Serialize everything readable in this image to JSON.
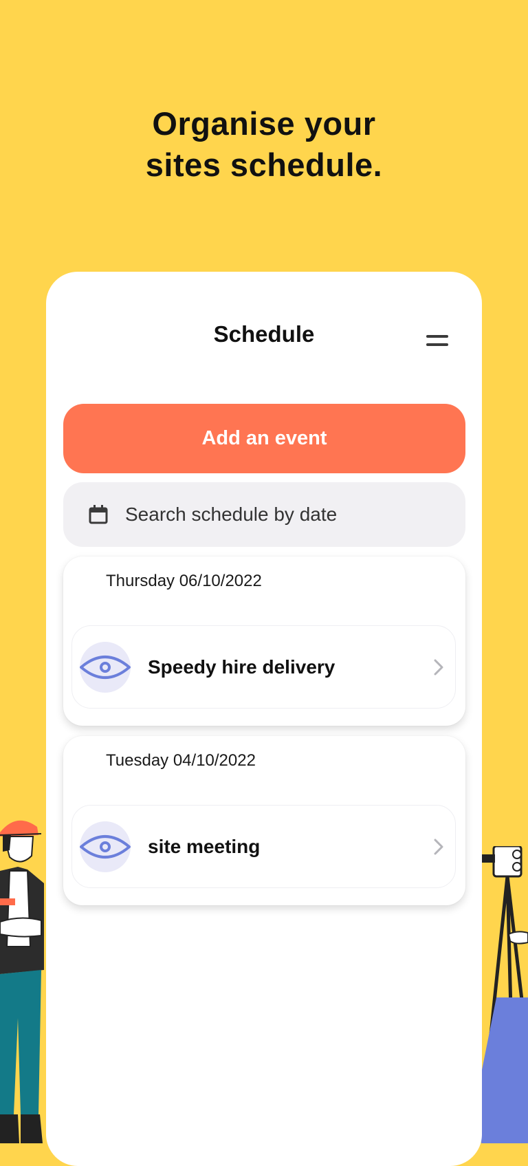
{
  "headline": {
    "line1": "Organise your",
    "line2": "sites schedule."
  },
  "header": {
    "title": "Schedule",
    "menu_icon": "hamburger-menu-icon"
  },
  "add_event": {
    "label": "Add an event"
  },
  "search": {
    "placeholder": "Search schedule by date",
    "icon": "calendar-icon"
  },
  "days": [
    {
      "date": "Thursday 06/10/2022",
      "events": [
        {
          "name": "Speedy hire delivery",
          "icon": "eye-icon"
        }
      ]
    },
    {
      "date": "Tuesday 04/10/2022",
      "events": [
        {
          "name": "site meeting",
          "icon": "eye-icon"
        }
      ]
    }
  ],
  "colors": {
    "background": "#FFD54D",
    "accent": "#FF7552",
    "eye_icon": "#6B7FDB",
    "search_bg": "#F1F0F3"
  }
}
